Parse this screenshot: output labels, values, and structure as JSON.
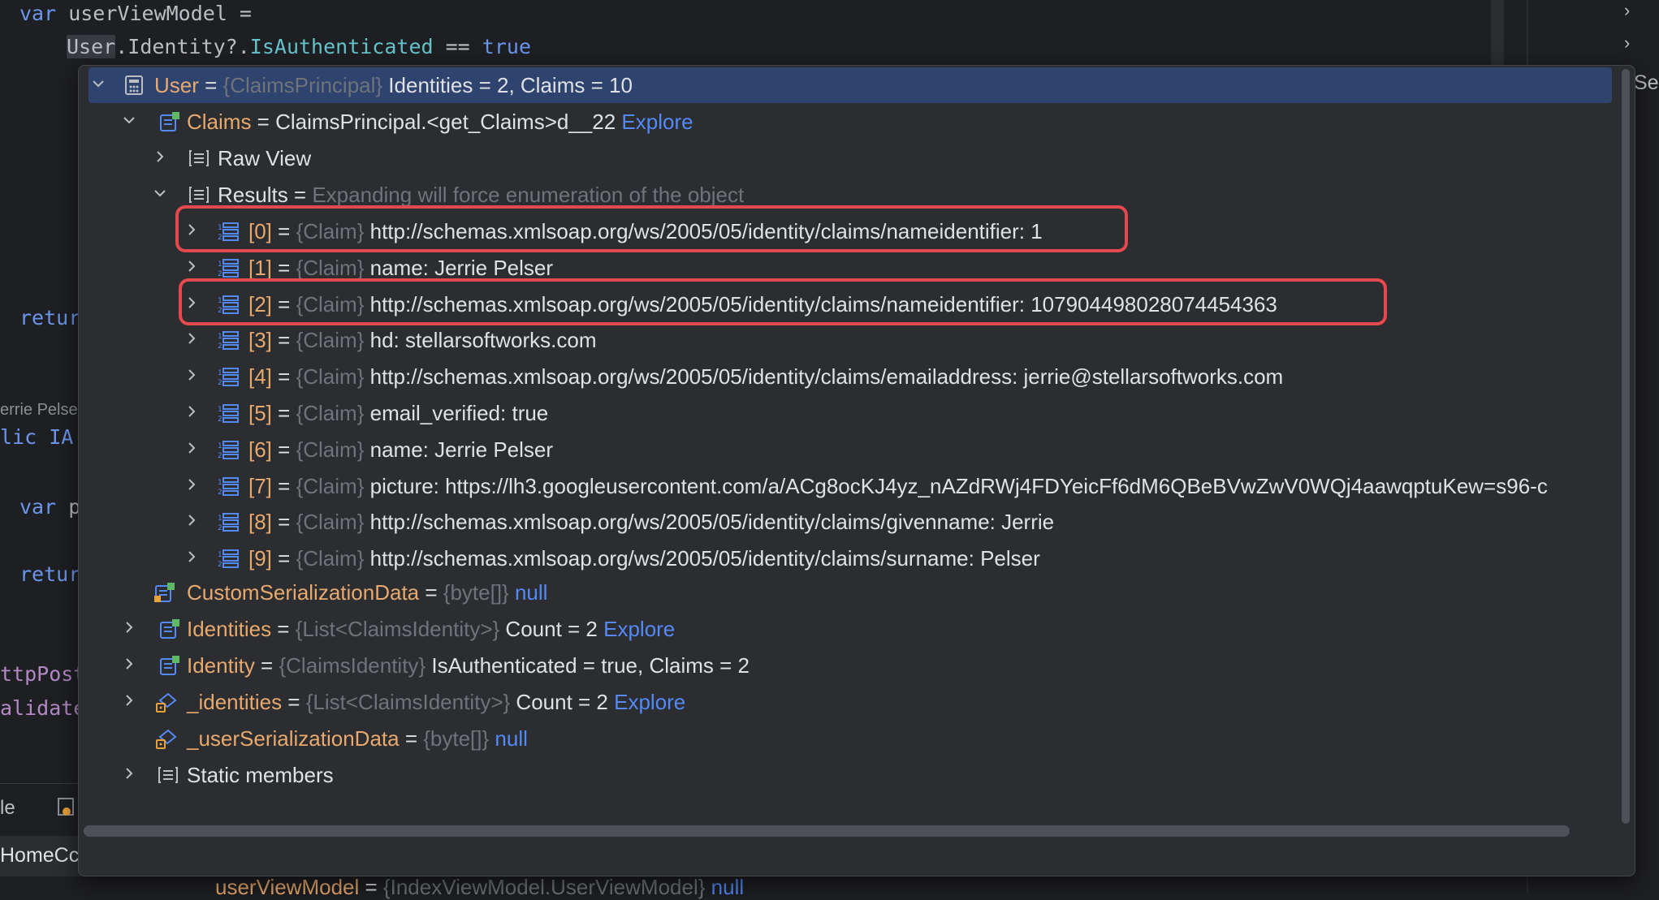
{
  "editor": {
    "line1_kw": "var",
    "line1_rest": " userViewModel =",
    "line2_user": "User",
    "line2_mid": ".Identity?.",
    "line2_prop": "IsAuthenticated",
    "line2_op": " == ",
    "line2_true": "true",
    "retur1": "retur",
    "hint_author": "errie Pelse",
    "lic": "lic IA",
    "var_p_kw": "var",
    "var_p_rest": " p",
    "retur2": "retur",
    "ttppost": "ttpPost",
    "alidate": "alidate",
    "le": "le",
    "homecc": "HomeCc",
    "right_ser": "Ser",
    "bottom_var_name": "userViewModel",
    "bottom_var_eq": " = ",
    "bottom_var_type": "{IndexViewModel.UserViewModel}",
    "bottom_var_null": " null"
  },
  "tree": {
    "user": {
      "name": "User",
      "eq": " = ",
      "type": "{ClaimsPrincipal}",
      "value": " Identities = 2, Claims = 10"
    },
    "claims": {
      "name": "Claims",
      "eq": " = ",
      "value": "ClaimsPrincipal.<get_Claims>d__22 ",
      "link": "Explore"
    },
    "raw_view": {
      "label": "Raw View"
    },
    "results": {
      "label": "Results",
      "eq": " = ",
      "value": "Expanding will force enumeration of the object"
    },
    "claim_items": [
      {
        "index": "[0]",
        "type": "{Claim}",
        "value": " http://schemas.xmlsoap.org/ws/2005/05/identity/claims/nameidentifier: 1"
      },
      {
        "index": "[1]",
        "type": "{Claim}",
        "value": " name: Jerrie Pelser"
      },
      {
        "index": "[2]",
        "type": "{Claim}",
        "value": " http://schemas.xmlsoap.org/ws/2005/05/identity/claims/nameidentifier: 107904498028074454363"
      },
      {
        "index": "[3]",
        "type": "{Claim}",
        "value": " hd: stellarsoftworks.com"
      },
      {
        "index": "[4]",
        "type": "{Claim}",
        "value": " http://schemas.xmlsoap.org/ws/2005/05/identity/claims/emailaddress: jerrie@stellarsoftworks.com"
      },
      {
        "index": "[5]",
        "type": "{Claim}",
        "value": " email_verified: true"
      },
      {
        "index": "[6]",
        "type": "{Claim}",
        "value": " name: Jerrie Pelser"
      },
      {
        "index": "[7]",
        "type": "{Claim}",
        "value": " picture: https://lh3.googleusercontent.com/a/ACg8ocKJ4yz_nAZdRWj4FDYeicFf6dM6QBeBVwZwV0WQj4aawqptuKew=s96-c"
      },
      {
        "index": "[8]",
        "type": "{Claim}",
        "value": " http://schemas.xmlsoap.org/ws/2005/05/identity/claims/givenname: Jerrie"
      },
      {
        "index": "[9]",
        "type": "{Claim}",
        "value": " http://schemas.xmlsoap.org/ws/2005/05/identity/claims/surname: Pelser"
      }
    ],
    "eq": " = ",
    "custom_serialization": {
      "name": "CustomSerializationData",
      "eq": " = ",
      "type": "{byte[]}",
      "value": " null"
    },
    "identities": {
      "name": "Identities",
      "eq": " = ",
      "type": "{List<ClaimsIdentity>}",
      "value": " Count = 2 ",
      "link": "Explore"
    },
    "identity": {
      "name": "Identity",
      "eq": " = ",
      "type": "{ClaimsIdentity}",
      "value": " IsAuthenticated = true, Claims = 2"
    },
    "_identities": {
      "name": "_identities",
      "eq": " = ",
      "type": "{List<ClaimsIdentity>}",
      "value": " Count = 2 ",
      "link": "Explore"
    },
    "_user_serialization": {
      "name": "_userSerializationData",
      "eq": " = ",
      "type": "{byte[]}",
      "value": " null"
    },
    "static_members": {
      "label": "Static members"
    }
  },
  "colors": {
    "highlight_box": "#e5484d",
    "selected_row": "#2e436e",
    "name": "#e8a96e",
    "link": "#548af7"
  }
}
